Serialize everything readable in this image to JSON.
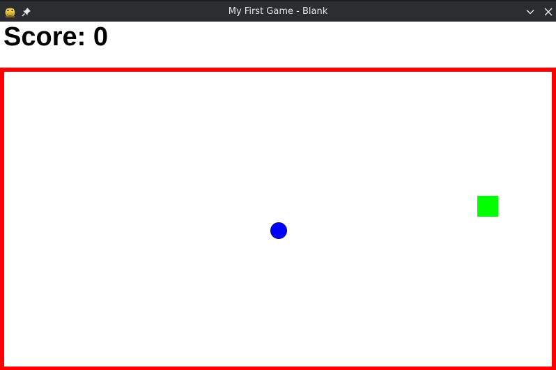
{
  "window": {
    "title": "My First Game - Blank",
    "app_icon": "pygame-snake-icon",
    "pin_icon": "pin-icon",
    "minimize_icon": "chevron-down-icon",
    "close_icon": "close-icon"
  },
  "game": {
    "score_label": "Score:",
    "score_value": "0",
    "colors": {
      "border": "#ff0000",
      "player": "#0000ff",
      "target": "#00ff00",
      "background": "#ffffff"
    },
    "objects": [
      {
        "name": "player-ball",
        "shape": "circle"
      },
      {
        "name": "target-square",
        "shape": "square"
      }
    ]
  }
}
